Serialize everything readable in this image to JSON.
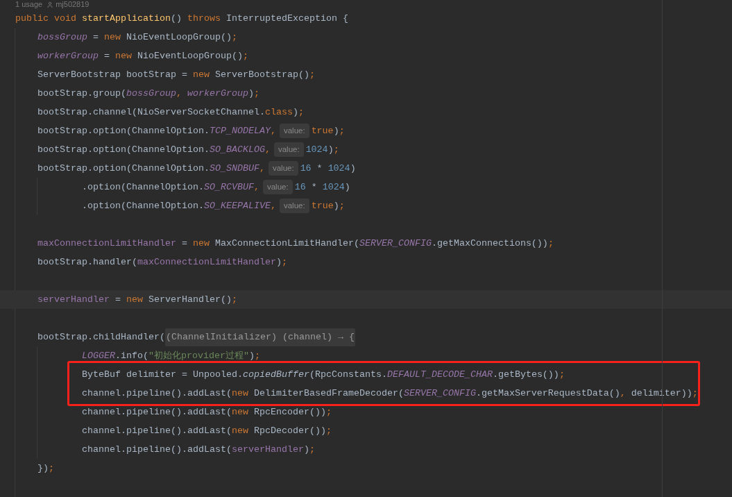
{
  "editor": {
    "usage_hint": {
      "usages": "1 usage",
      "author": "mj502819"
    },
    "lines": [
      {
        "kind": "code",
        "current": false,
        "highlighted": false,
        "segments": [
          {
            "kind": "code",
            "tokens": [
              {
                "kind": "keyword",
                "text": "public void "
              },
              {
                "kind": "declaration",
                "text": "startApplication"
              },
              {
                "kind": "plain",
                "text": "() "
              },
              {
                "kind": "keyword",
                "text": "throws "
              },
              {
                "kind": "plain",
                "text": "InterruptedException {"
              }
            ]
          }
        ],
        "children": [
          {
            "kind": "code",
            "current": false,
            "highlighted": false,
            "segments": [
              {
                "kind": "code",
                "tokens": [
                  {
                    "kind": "static_field",
                    "text": "bossGroup"
                  },
                  {
                    "kind": "plain",
                    "text": " = "
                  },
                  {
                    "kind": "keyword",
                    "text": "new "
                  },
                  {
                    "kind": "plain",
                    "text": "NioEventLoopGroup()"
                  },
                  {
                    "kind": "punctuation",
                    "text": ";"
                  }
                ]
              }
            ]
          },
          {
            "kind": "code",
            "current": false,
            "highlighted": false,
            "segments": [
              {
                "kind": "code",
                "tokens": [
                  {
                    "kind": "static_field",
                    "text": "workerGroup"
                  },
                  {
                    "kind": "plain",
                    "text": " = "
                  },
                  {
                    "kind": "keyword",
                    "text": "new "
                  },
                  {
                    "kind": "plain",
                    "text": "NioEventLoopGroup()"
                  },
                  {
                    "kind": "punctuation",
                    "text": ";"
                  }
                ]
              }
            ]
          },
          {
            "kind": "code",
            "current": false,
            "highlighted": false,
            "segments": [
              {
                "kind": "code",
                "tokens": [
                  {
                    "kind": "plain",
                    "text": "ServerBootstrap bootStrap = "
                  },
                  {
                    "kind": "keyword",
                    "text": "new "
                  },
                  {
                    "kind": "plain",
                    "text": "ServerBootstrap()"
                  },
                  {
                    "kind": "punctuation",
                    "text": ";"
                  }
                ]
              }
            ]
          },
          {
            "kind": "code",
            "current": false,
            "highlighted": false,
            "segments": [
              {
                "kind": "code",
                "tokens": [
                  {
                    "kind": "plain",
                    "text": "bootStrap.group("
                  },
                  {
                    "kind": "static_field",
                    "text": "bossGroup"
                  },
                  {
                    "kind": "punctuation",
                    "text": ", "
                  },
                  {
                    "kind": "static_field",
                    "text": "workerGroup"
                  },
                  {
                    "kind": "plain",
                    "text": ")"
                  },
                  {
                    "kind": "punctuation",
                    "text": ";"
                  }
                ]
              }
            ]
          },
          {
            "kind": "code",
            "current": false,
            "highlighted": false,
            "segments": [
              {
                "kind": "code",
                "tokens": [
                  {
                    "kind": "plain",
                    "text": "bootStrap.channel(NioServerSocketChannel."
                  },
                  {
                    "kind": "keyword",
                    "text": "class"
                  },
                  {
                    "kind": "plain",
                    "text": ")"
                  },
                  {
                    "kind": "punctuation",
                    "text": ";"
                  }
                ]
              }
            ]
          },
          {
            "kind": "code",
            "current": false,
            "highlighted": false,
            "segments": [
              {
                "kind": "code",
                "tokens": [
                  {
                    "kind": "plain",
                    "text": "bootStrap.option(ChannelOption."
                  },
                  {
                    "kind": "constant",
                    "text": "TCP_NODELAY"
                  },
                  {
                    "kind": "punctuation",
                    "text": ","
                  }
                ]
              },
              {
                "kind": "hint",
                "text": "value:"
              },
              {
                "kind": "code",
                "tokens": [
                  {
                    "kind": "keyword",
                    "text": "true"
                  },
                  {
                    "kind": "plain",
                    "text": ")"
                  },
                  {
                    "kind": "punctuation",
                    "text": ";"
                  }
                ]
              }
            ]
          },
          {
            "kind": "code",
            "current": false,
            "highlighted": false,
            "segments": [
              {
                "kind": "code",
                "tokens": [
                  {
                    "kind": "plain",
                    "text": "bootStrap.option(ChannelOption."
                  },
                  {
                    "kind": "constant",
                    "text": "SO_BACKLOG"
                  },
                  {
                    "kind": "punctuation",
                    "text": ","
                  }
                ]
              },
              {
                "kind": "hint",
                "text": "value:"
              },
              {
                "kind": "code",
                "tokens": [
                  {
                    "kind": "number",
                    "text": "1024"
                  },
                  {
                    "kind": "plain",
                    "text": ")"
                  },
                  {
                    "kind": "punctuation",
                    "text": ";"
                  }
                ]
              }
            ]
          },
          {
            "kind": "code",
            "current": false,
            "highlighted": false,
            "segments": [
              {
                "kind": "code",
                "tokens": [
                  {
                    "kind": "plain",
                    "text": "bootStrap.option(ChannelOption."
                  },
                  {
                    "kind": "constant",
                    "text": "SO_SNDBUF"
                  },
                  {
                    "kind": "punctuation",
                    "text": ","
                  }
                ]
              },
              {
                "kind": "hint",
                "text": "value:"
              },
              {
                "kind": "code",
                "tokens": [
                  {
                    "kind": "number",
                    "text": "16"
                  },
                  {
                    "kind": "plain",
                    "text": " * "
                  },
                  {
                    "kind": "number",
                    "text": "1024"
                  },
                  {
                    "kind": "plain",
                    "text": ")"
                  }
                ]
              }
            ],
            "children": [
              {
                "kind": "code",
                "current": false,
                "highlighted": false,
                "segments": [
                  {
                    "kind": "code",
                    "tokens": [
                      {
                        "kind": "plain",
                        "text": ".option(ChannelOption."
                      },
                      {
                        "kind": "constant",
                        "text": "SO_RCVBUF"
                      },
                      {
                        "kind": "punctuation",
                        "text": ","
                      }
                    ]
                  },
                  {
                    "kind": "hint",
                    "text": "value:"
                  },
                  {
                    "kind": "code",
                    "tokens": [
                      {
                        "kind": "number",
                        "text": "16"
                      },
                      {
                        "kind": "plain",
                        "text": " * "
                      },
                      {
                        "kind": "number",
                        "text": "1024"
                      },
                      {
                        "kind": "plain",
                        "text": ")"
                      }
                    ]
                  }
                ]
              },
              {
                "kind": "code",
                "current": false,
                "highlighted": false,
                "segments": [
                  {
                    "kind": "code",
                    "tokens": [
                      {
                        "kind": "plain",
                        "text": ".option(ChannelOption."
                      },
                      {
                        "kind": "constant",
                        "text": "SO_KEEPALIVE"
                      },
                      {
                        "kind": "punctuation",
                        "text": ","
                      }
                    ]
                  },
                  {
                    "kind": "hint",
                    "text": "value:"
                  },
                  {
                    "kind": "code",
                    "tokens": [
                      {
                        "kind": "keyword",
                        "text": "true"
                      },
                      {
                        "kind": "plain",
                        "text": ")"
                      },
                      {
                        "kind": "punctuation",
                        "text": ";"
                      }
                    ]
                  }
                ]
              }
            ]
          },
          {
            "kind": "blank",
            "current": false,
            "highlighted": false
          },
          {
            "kind": "code",
            "current": false,
            "highlighted": false,
            "segments": [
              {
                "kind": "code",
                "tokens": [
                  {
                    "kind": "field",
                    "text": "maxConnectionLimitHandler"
                  },
                  {
                    "kind": "plain",
                    "text": " = "
                  },
                  {
                    "kind": "keyword",
                    "text": "new "
                  },
                  {
                    "kind": "plain",
                    "text": "MaxConnectionLimitHandler("
                  },
                  {
                    "kind": "constant",
                    "text": "SERVER_CONFIG"
                  },
                  {
                    "kind": "plain",
                    "text": ".getMaxConnections())"
                  },
                  {
                    "kind": "punctuation",
                    "text": ";"
                  }
                ]
              }
            ]
          },
          {
            "kind": "code",
            "current": false,
            "highlighted": false,
            "segments": [
              {
                "kind": "code",
                "tokens": [
                  {
                    "kind": "plain",
                    "text": "bootStrap.handler("
                  },
                  {
                    "kind": "field",
                    "text": "maxConnectionLimitHandler"
                  },
                  {
                    "kind": "plain",
                    "text": ")"
                  },
                  {
                    "kind": "punctuation",
                    "text": ";"
                  }
                ]
              }
            ]
          },
          {
            "kind": "blank",
            "current": false,
            "highlighted": false
          },
          {
            "kind": "code",
            "current": true,
            "highlighted": false,
            "segments": [
              {
                "kind": "code",
                "tokens": [
                  {
                    "kind": "field",
                    "text": "serverHandler"
                  },
                  {
                    "kind": "plain",
                    "text": " = "
                  },
                  {
                    "kind": "keyword",
                    "text": "new "
                  },
                  {
                    "kind": "plain",
                    "text": "ServerHandler()"
                  },
                  {
                    "kind": "punctuation",
                    "text": ";"
                  }
                ]
              }
            ]
          },
          {
            "kind": "blank",
            "current": false,
            "highlighted": false
          },
          {
            "kind": "code",
            "current": false,
            "highlighted": false,
            "segments": [
              {
                "kind": "code",
                "tokens": [
                  {
                    "kind": "plain",
                    "text": "bootStrap.childHandler("
                  }
                ]
              },
              {
                "kind": "fold",
                "text": "(ChannelInitializer) (channel) → {"
              }
            ],
            "children": [
              {
                "kind": "code",
                "current": false,
                "highlighted": false,
                "segments": [
                  {
                    "kind": "code",
                    "tokens": [
                      {
                        "kind": "constant",
                        "text": "LOGGER"
                      },
                      {
                        "kind": "plain",
                        "text": ".info("
                      },
                      {
                        "kind": "string",
                        "text": "\"初始化provider过程\""
                      },
                      {
                        "kind": "plain",
                        "text": ")"
                      },
                      {
                        "kind": "punctuation",
                        "text": ";"
                      }
                    ]
                  }
                ]
              },
              {
                "kind": "code",
                "current": false,
                "highlighted": true,
                "segments": [
                  {
                    "kind": "code",
                    "tokens": [
                      {
                        "kind": "plain",
                        "text": "ByteBuf delimiter = Unpooled."
                      },
                      {
                        "kind": "static_call",
                        "text": "copiedBuffer"
                      },
                      {
                        "kind": "plain",
                        "text": "(RpcConstants."
                      },
                      {
                        "kind": "constant",
                        "text": "DEFAULT_DECODE_CHAR"
                      },
                      {
                        "kind": "plain",
                        "text": ".getBytes())"
                      },
                      {
                        "kind": "punctuation",
                        "text": ";"
                      }
                    ]
                  }
                ]
              },
              {
                "kind": "code",
                "current": false,
                "highlighted": true,
                "segments": [
                  {
                    "kind": "code",
                    "tokens": [
                      {
                        "kind": "plain",
                        "text": "channel.pipeline().addLast("
                      },
                      {
                        "kind": "keyword",
                        "text": "new "
                      },
                      {
                        "kind": "plain",
                        "text": "DelimiterBasedFrameDecoder("
                      },
                      {
                        "kind": "constant",
                        "text": "SERVER_CONFIG"
                      },
                      {
                        "kind": "plain",
                        "text": ".getMaxServerRequestData()"
                      },
                      {
                        "kind": "punctuation",
                        "text": ", "
                      },
                      {
                        "kind": "plain",
                        "text": "delimiter))"
                      },
                      {
                        "kind": "punctuation",
                        "text": ";"
                      }
                    ]
                  }
                ]
              },
              {
                "kind": "code",
                "current": false,
                "highlighted": false,
                "segments": [
                  {
                    "kind": "code",
                    "tokens": [
                      {
                        "kind": "plain",
                        "text": "channel.pipeline().addLast("
                      },
                      {
                        "kind": "keyword",
                        "text": "new "
                      },
                      {
                        "kind": "plain",
                        "text": "RpcEncoder())"
                      },
                      {
                        "kind": "punctuation",
                        "text": ";"
                      }
                    ]
                  }
                ]
              },
              {
                "kind": "code",
                "current": false,
                "highlighted": false,
                "segments": [
                  {
                    "kind": "code",
                    "tokens": [
                      {
                        "kind": "plain",
                        "text": "channel.pipeline().addLast("
                      },
                      {
                        "kind": "keyword",
                        "text": "new "
                      },
                      {
                        "kind": "plain",
                        "text": "RpcDecoder())"
                      },
                      {
                        "kind": "punctuation",
                        "text": ";"
                      }
                    ]
                  }
                ]
              },
              {
                "kind": "code",
                "current": false,
                "highlighted": false,
                "segments": [
                  {
                    "kind": "code",
                    "tokens": [
                      {
                        "kind": "plain",
                        "text": "channel.pipeline().addLast("
                      },
                      {
                        "kind": "field",
                        "text": "serverHandler"
                      },
                      {
                        "kind": "plain",
                        "text": ")"
                      },
                      {
                        "kind": "punctuation",
                        "text": ";"
                      }
                    ]
                  }
                ]
              }
            ]
          },
          {
            "kind": "code",
            "current": false,
            "highlighted": false,
            "segments": [
              {
                "kind": "code",
                "tokens": [
                  {
                    "kind": "plain",
                    "text": "})"
                  },
                  {
                    "kind": "punctuation",
                    "text": ";"
                  }
                ]
              }
            ]
          }
        ]
      }
    ]
  }
}
